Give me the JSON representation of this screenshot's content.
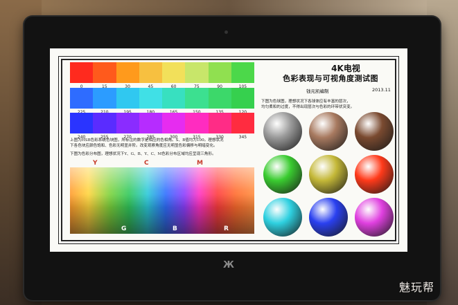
{
  "screen": {
    "title_line1": "4K电视",
    "title_line2": "色彩表现与可视角度测试图",
    "author": "钱元凯编制",
    "year": "2013.11",
    "row1_labels": [
      "0",
      "15",
      "30",
      "45",
      "60",
      "75",
      "90",
      "105"
    ],
    "row2_labels": [
      "225",
      "210",
      "195",
      "180",
      "165",
      "150",
      "135",
      "120"
    ],
    "row3_labels": [
      "240",
      "255",
      "270",
      "285",
      "300",
      "315",
      "330",
      "345"
    ],
    "row1_colors": [
      "#ff2a1e",
      "#ff5a1c",
      "#ff9a1c",
      "#f7c040",
      "#f2e05a",
      "#c8e66a",
      "#90e050",
      "#4cd84a"
    ],
    "row2_colors": [
      "#2e6cff",
      "#2c9cff",
      "#30c8f0",
      "#40e0e6",
      "#38e0c0",
      "#3ce090",
      "#3cd86a",
      "#36d04e"
    ],
    "row3_colors": [
      "#2a34ff",
      "#5a2cff",
      "#8a2cff",
      "#b62cff",
      "#e62cf0",
      "#ff2cc0",
      "#ff2c86",
      "#ff2c40"
    ],
    "hue_caption_1": "上图为HSB色彩系统色块图，所标注的数字是相应的色相角。S、B值均为100。理想状况",
    "hue_caption_2": "下各色块应颜色饱和、色彩无明显并阶。改变观察角度应无明显色彩偏移与明暗变化。",
    "map_caption": "下图为色彩分布图，理想状况下Y、G、B、Y、C、M色彩分布区域均应呈现三角形。",
    "map_top_letters": [
      "Y",
      "C",
      "M"
    ],
    "map_bottom_letters": [
      "G",
      "B",
      "R"
    ],
    "ball_caption_1": "下图为色球图，理想状况下各球体应有丰富的层次，",
    "ball_caption_2": "均匀柔和的过度，不得出现层次与色彩的环带状突变。",
    "balls": [
      {
        "name": "gray",
        "color": "#9a9a9a"
      },
      {
        "name": "tan",
        "color": "#a87a60"
      },
      {
        "name": "brown",
        "color": "#7a4a30"
      },
      {
        "name": "green",
        "color": "#3acc30"
      },
      {
        "name": "olive",
        "color": "#c4b838"
      },
      {
        "name": "red",
        "color": "#ff3a1a"
      },
      {
        "name": "cyan",
        "color": "#2ed0e0"
      },
      {
        "name": "blue",
        "color": "#2a40f0"
      },
      {
        "name": "magenta",
        "color": "#e040e0"
      }
    ]
  },
  "bezel_logo": "Ж",
  "watermark": "魅玩帮"
}
